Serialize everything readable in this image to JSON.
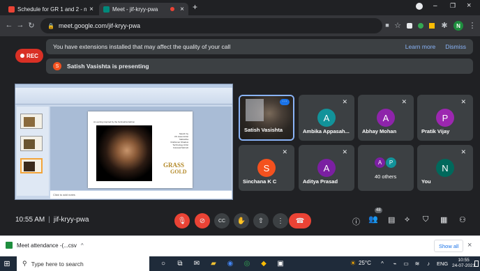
{
  "browser": {
    "tabs": [
      {
        "title": "Schedule for GR 1 and 2 - nithil...",
        "favicon": "gmail-icon",
        "color": "#ea4335"
      },
      {
        "title": "Meet - jif-kryy-pwa",
        "favicon": "meet-icon",
        "color": "#00897b"
      }
    ],
    "new_tab_symbol": "+",
    "url": "meet.google.com/jif-kryy-pwa",
    "profile_initial": "N"
  },
  "meet": {
    "rec_label": "REC",
    "extension_banner": "You have extensions installed that may affect the quality of your call",
    "learn_more": "Learn more",
    "dismiss": "Dismiss",
    "presenter_initial": "S",
    "presenting_text": "Satish Vasishta is presenting",
    "slide": {
      "title": "An earring inspired by the Kehmehta fashion",
      "side_text": "Sketch by\nUS Jewel Artist\nMahwitha\nDraftsman Shadow\nTechnology Artist\nColossal Mehndi",
      "logo_top": "GRASS",
      "logo_bottom": "GOLD",
      "notes_placeholder": "Click to add notes"
    },
    "participants": [
      {
        "name": "Satish Vasishta",
        "initial": "",
        "color": "#5f6368",
        "has_video": true
      },
      {
        "name": "Ambika Appasah...",
        "initial": "A",
        "color": "#12939a"
      },
      {
        "name": "Abhay Mohan",
        "initial": "A",
        "color": "#8e24aa"
      },
      {
        "name": "Pratik Vijay",
        "initial": "P",
        "color": "#9c27b0"
      },
      {
        "name": "Sinchana K C",
        "initial": "S",
        "color": "#f4511e"
      },
      {
        "name": "Aditya Prasad",
        "initial": "A",
        "color": "#7b1fa2"
      },
      {
        "name": "40 others",
        "initial": "",
        "color": "#3c4043",
        "group": [
          "A",
          "P"
        ]
      },
      {
        "name": "You",
        "initial": "N",
        "color": "#00695c"
      }
    ],
    "time": "10:55 AM",
    "separator": "|",
    "meeting_code": "jif-kryy-pwa",
    "people_count": "48"
  },
  "shelf": {
    "download_name": "Meet attendance -(...csv",
    "show_all": "Show all"
  },
  "taskbar": {
    "search_placeholder": "Type here to search",
    "weather": "25°C",
    "language": "ENG",
    "clock_time": "10:55",
    "clock_date": "24-07-2021"
  }
}
